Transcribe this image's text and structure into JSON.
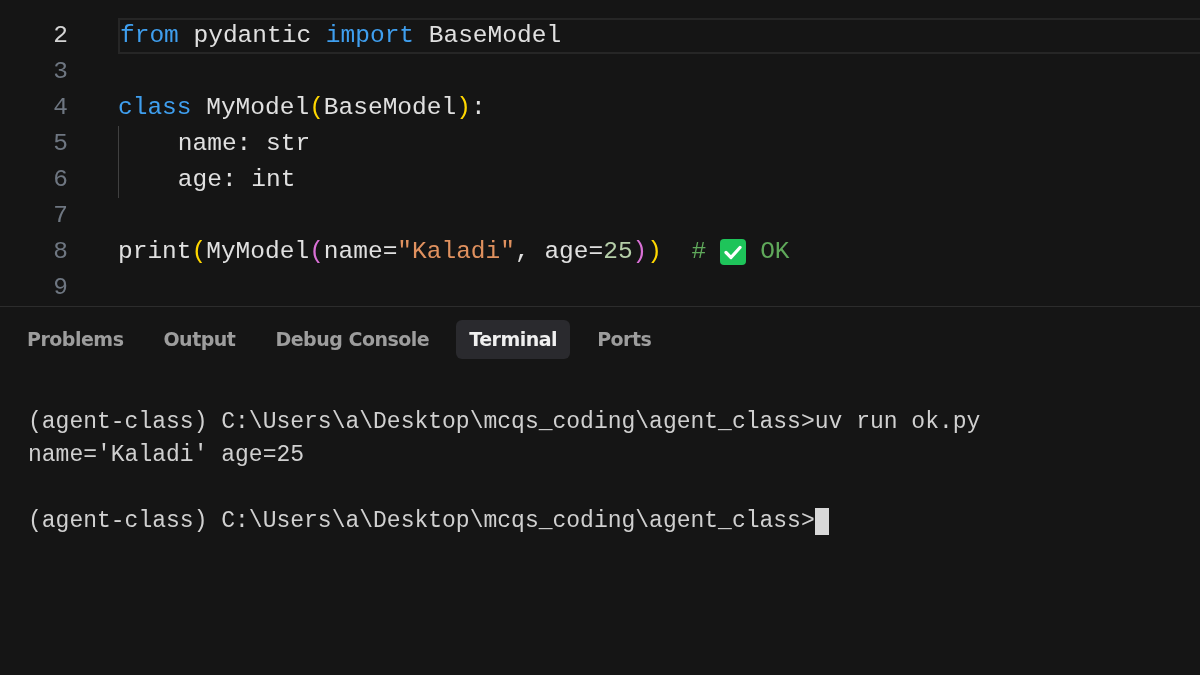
{
  "editor": {
    "lines": [
      {
        "number": "2",
        "active": true,
        "tokens": [
          {
            "kind": "keyword",
            "text": "from"
          },
          {
            "kind": "plain",
            "text": " pydantic "
          },
          {
            "kind": "keyword",
            "text": "import"
          },
          {
            "kind": "plain",
            "text": " BaseModel"
          }
        ]
      },
      {
        "number": "3",
        "active": false
      },
      {
        "number": "4",
        "active": false,
        "tokens": [
          {
            "kind": "keyword",
            "text": "class"
          },
          {
            "kind": "plain",
            "text": " MyModel"
          },
          {
            "kind": "paren1",
            "text": "("
          },
          {
            "kind": "plain",
            "text": "BaseModel"
          },
          {
            "kind": "paren1",
            "text": ")"
          },
          {
            "kind": "plain",
            "text": ":"
          }
        ]
      },
      {
        "number": "5",
        "active": false,
        "indent_guide": true,
        "tokens": [
          {
            "kind": "plain",
            "text": "    name: str"
          }
        ]
      },
      {
        "number": "6",
        "active": false,
        "indent_guide": true,
        "tokens": [
          {
            "kind": "plain",
            "text": "    age: int"
          }
        ]
      },
      {
        "number": "7",
        "active": false
      },
      {
        "number": "8",
        "active": false,
        "tokens": [
          {
            "kind": "plain",
            "text": "print"
          },
          {
            "kind": "paren1",
            "text": "("
          },
          {
            "kind": "plain",
            "text": "MyModel"
          },
          {
            "kind": "paren2",
            "text": "("
          },
          {
            "kind": "plain",
            "text": "name="
          },
          {
            "kind": "string",
            "text": "\"Kaladi\""
          },
          {
            "kind": "plain",
            "text": ", age="
          },
          {
            "kind": "number",
            "text": "25"
          },
          {
            "kind": "paren2",
            "text": ")"
          },
          {
            "kind": "paren1",
            "text": ")"
          },
          {
            "kind": "comment",
            "text": "  #"
          },
          {
            "kind": "icon"
          },
          {
            "kind": "comment",
            "text": "OK"
          }
        ]
      },
      {
        "number": "9",
        "active": false
      }
    ]
  },
  "panel": {
    "tabs": [
      {
        "label": "Problems",
        "selected": false
      },
      {
        "label": "Output",
        "selected": false
      },
      {
        "label": "Debug Console",
        "selected": false
      },
      {
        "label": "Terminal",
        "selected": true
      },
      {
        "label": "Ports",
        "selected": false
      }
    ],
    "terminal": [
      {
        "kind": "command",
        "text": "(agent-class) C:\\Users\\a\\Desktop\\mcqs_coding\\agent_class>uv run ok.py"
      },
      {
        "kind": "output",
        "text": "name='Kaladi' age=25"
      },
      {
        "kind": "prompt",
        "text": "(agent-class) C:\\Users\\a\\Desktop\\mcqs_coding\\agent_class>"
      }
    ]
  }
}
